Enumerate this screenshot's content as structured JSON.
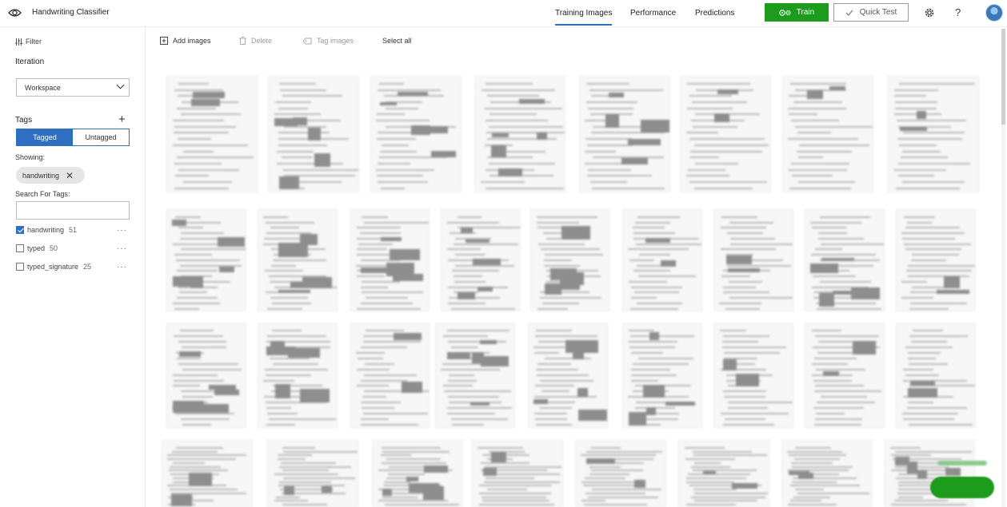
{
  "app": {
    "title": "Handwriting Classifier"
  },
  "nav": {
    "training_images": "Training Images",
    "performance": "Performance",
    "predictions": "Predictions"
  },
  "actions": {
    "train": "Train",
    "quick_test": "Quick Test",
    "help": "?"
  },
  "sidebar": {
    "filter": "Filter",
    "iteration_label": "Iteration",
    "iteration_value": "Workspace",
    "tags_label": "Tags",
    "segment": {
      "tagged": "Tagged",
      "untagged": "Untagged",
      "selected": "Tagged"
    },
    "showing_label": "Showing:",
    "showing_chip": "handwriting",
    "search_label": "Search For Tags:",
    "search_value": "",
    "tags": [
      {
        "name": "handwriting",
        "count": "51",
        "checked": true
      },
      {
        "name": "typed",
        "count": "50",
        "checked": false
      },
      {
        "name": "typed_signature",
        "count": "25",
        "checked": false
      }
    ]
  },
  "toolbar": {
    "add_images": "Add images",
    "delete": "Delete",
    "tag_images": "Tag images",
    "select_all": "Select all"
  },
  "colors": {
    "accent": "#2f6fbf",
    "train_green": "#1d9b1d"
  },
  "icons": [
    "eye-icon",
    "train-icon",
    "check-icon",
    "gear-icon",
    "filter-icon",
    "chevron-down-icon",
    "plus-icon",
    "close-icon",
    "add-image-icon",
    "trash-icon",
    "tag-icon"
  ]
}
